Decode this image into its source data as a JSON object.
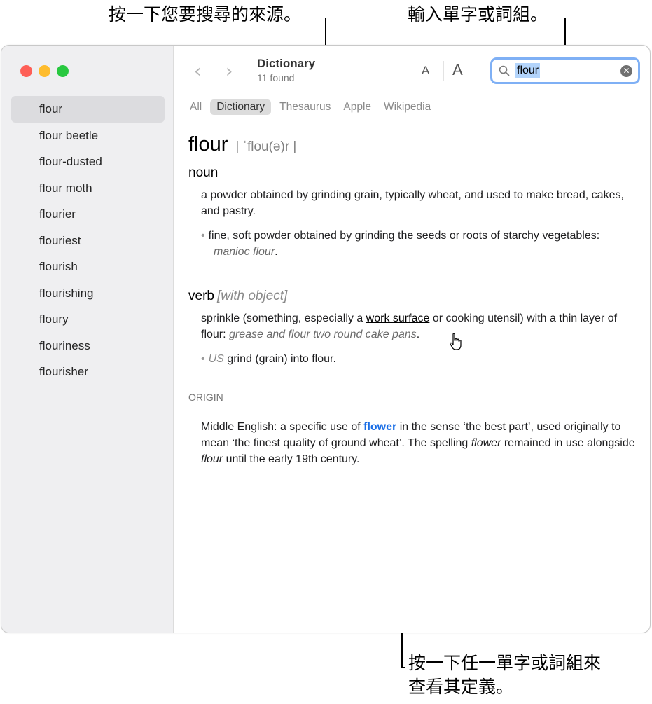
{
  "callouts": {
    "sources": "按一下您要搜尋的來源。",
    "word": "輸入單字或詞組。",
    "click_line1": "按一下任一單字或詞組來",
    "click_line2": "查看其定義。"
  },
  "window": {
    "title": "Dictionary",
    "subtitle": "11 found",
    "font_small": "A",
    "font_large": "A",
    "nav_back": "‹",
    "nav_forward": "›"
  },
  "search": {
    "value": "flour",
    "clear_icon": "close-circle-icon"
  },
  "tabs": [
    {
      "label": "All"
    },
    {
      "label": "Dictionary",
      "active": true
    },
    {
      "label": "Thesaurus"
    },
    {
      "label": "Apple"
    },
    {
      "label": "Wikipedia"
    }
  ],
  "sidebar": {
    "items": [
      {
        "label": "flour",
        "selected": true
      },
      {
        "label": "flour beetle"
      },
      {
        "label": "flour-dusted"
      },
      {
        "label": "flour moth"
      },
      {
        "label": "flourier"
      },
      {
        "label": "flouriest"
      },
      {
        "label": "flourish"
      },
      {
        "label": "flourishing"
      },
      {
        "label": "floury"
      },
      {
        "label": "flouriness"
      },
      {
        "label": "flourisher"
      }
    ]
  },
  "entry": {
    "headword": "flour",
    "pronunciation": "| ˈflou(ə)r |",
    "noun": {
      "pos": "noun",
      "definition": "a powder obtained by grinding grain, typically wheat, and used to make bread, cakes, and pastry.",
      "bullet": "•",
      "sub_definition": "fine, soft powder obtained by grinding the seeds or roots of starchy vegetables: ",
      "sub_example": "manioc flour",
      "sub_end": "."
    },
    "verb": {
      "pos": "verb",
      "note": "[with object]",
      "definition_part1": "sprinkle (something, especially a ",
      "definition_link": "work surface",
      "definition_part2": " or cooking utensil) with a thin layer of flour: ",
      "example": "grease and flour two round cake pans",
      "example_end": ".",
      "bullet": "•",
      "sub_usage": "US",
      "sub_definition": " grind (grain) into flour."
    },
    "origin": {
      "label": "ORIGIN",
      "part1": "Middle English: a specific use of ",
      "xref": "flower",
      "part2": " in the sense ‘the best part’, used originally to mean ‘the finest quality of ground wheat’. The spelling ",
      "italic1": "flower",
      "part3": " remained in use alongside ",
      "italic2": "flour",
      "part4": " until the early 19th century."
    }
  },
  "colors": {
    "accent": "#1a6ee6",
    "search_focus": "#7fb0f5",
    "traffic_red": "#fe5f57",
    "traffic_yellow": "#febc2e",
    "traffic_green": "#28c840"
  }
}
